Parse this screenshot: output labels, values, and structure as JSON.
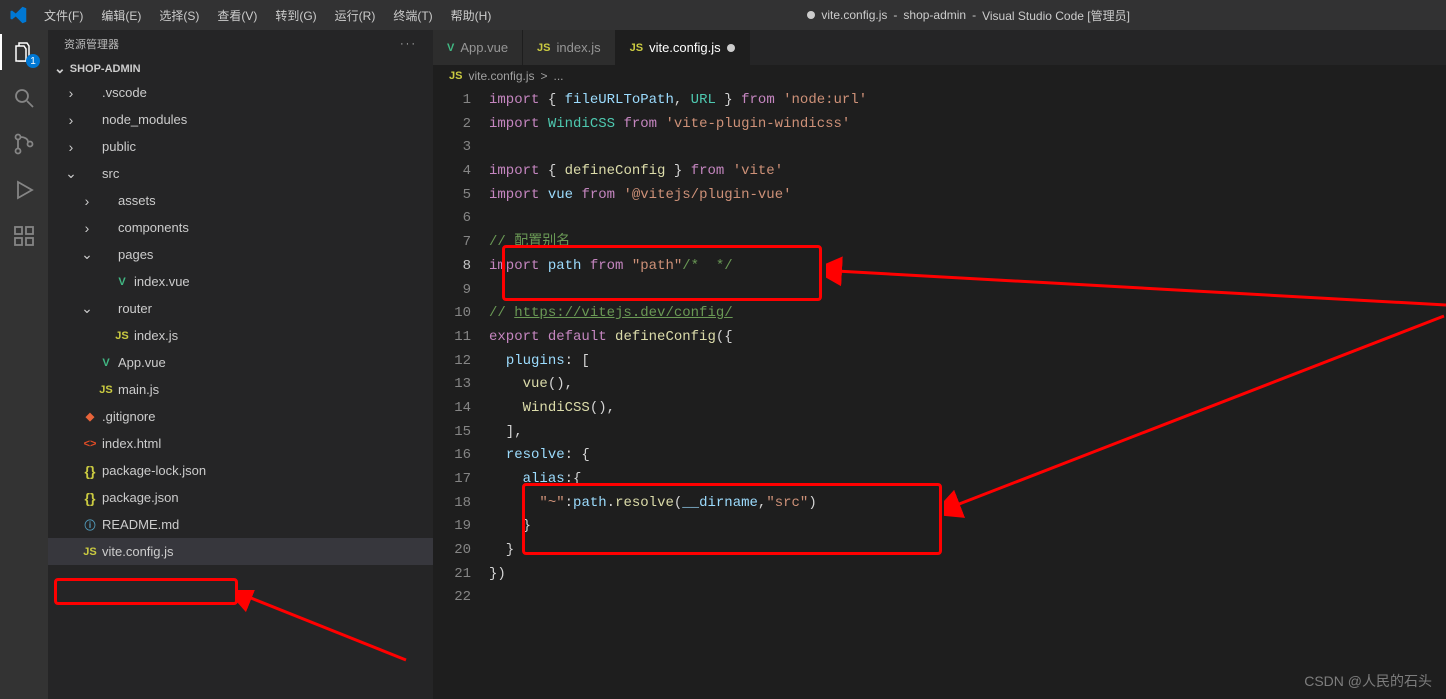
{
  "titlebar": {
    "menus": [
      "文件(F)",
      "编辑(E)",
      "选择(S)",
      "查看(V)",
      "转到(G)",
      "运行(R)",
      "终端(T)",
      "帮助(H)"
    ],
    "title_file": "vite.config.js",
    "title_project": "shop-admin",
    "title_app": "Visual Studio Code [管理员]"
  },
  "activitybar": {
    "badge": "1"
  },
  "sidebar": {
    "title": "资源管理器",
    "folder": "SHOP-ADMIN",
    "tree": [
      {
        "indent": 0,
        "twisty": ">",
        "icon": "",
        "label": ".vscode",
        "type": "folder"
      },
      {
        "indent": 0,
        "twisty": ">",
        "icon": "",
        "label": "node_modules",
        "type": "folder"
      },
      {
        "indent": 0,
        "twisty": ">",
        "icon": "",
        "label": "public",
        "type": "folder"
      },
      {
        "indent": 0,
        "twisty": "v",
        "icon": "",
        "label": "src",
        "type": "folder"
      },
      {
        "indent": 1,
        "twisty": ">",
        "icon": "",
        "label": "assets",
        "type": "folder"
      },
      {
        "indent": 1,
        "twisty": ">",
        "icon": "",
        "label": "components",
        "type": "folder"
      },
      {
        "indent": 1,
        "twisty": "v",
        "icon": "",
        "label": "pages",
        "type": "folder"
      },
      {
        "indent": 2,
        "twisty": "",
        "icon": "vue",
        "label": "index.vue",
        "type": "file"
      },
      {
        "indent": 1,
        "twisty": "v",
        "icon": "",
        "label": "router",
        "type": "folder"
      },
      {
        "indent": 2,
        "twisty": "",
        "icon": "js",
        "label": "index.js",
        "type": "file"
      },
      {
        "indent": 1,
        "twisty": "",
        "icon": "vue",
        "label": "App.vue",
        "type": "file"
      },
      {
        "indent": 1,
        "twisty": "",
        "icon": "js",
        "label": "main.js",
        "type": "file"
      },
      {
        "indent": 0,
        "twisty": "",
        "icon": "git",
        "label": ".gitignore",
        "type": "file"
      },
      {
        "indent": 0,
        "twisty": "",
        "icon": "html",
        "label": "index.html",
        "type": "file"
      },
      {
        "indent": 0,
        "twisty": "",
        "icon": "json",
        "label": "package-lock.json",
        "type": "file"
      },
      {
        "indent": 0,
        "twisty": "",
        "icon": "json",
        "label": "package.json",
        "type": "file"
      },
      {
        "indent": 0,
        "twisty": "",
        "icon": "md",
        "label": "README.md",
        "type": "file"
      },
      {
        "indent": 0,
        "twisty": "",
        "icon": "js",
        "label": "vite.config.js",
        "type": "file",
        "selected": true
      }
    ]
  },
  "tabs": [
    {
      "icon": "vue",
      "label": "App.vue",
      "active": false,
      "dirty": false
    },
    {
      "icon": "js",
      "label": "index.js",
      "active": false,
      "dirty": false
    },
    {
      "icon": "js",
      "label": "vite.config.js",
      "active": true,
      "dirty": true
    }
  ],
  "breadcrumbs": {
    "icon": "js",
    "file": "vite.config.js",
    "sep": ">",
    "rest": "..."
  },
  "code": {
    "lines": [
      {
        "n": 1,
        "seg": [
          [
            "k",
            "import"
          ],
          [
            "p",
            " { "
          ],
          [
            "v",
            "fileURLToPath"
          ],
          [
            "p",
            ", "
          ],
          [
            "t",
            "URL"
          ],
          [
            "p",
            " } "
          ],
          [
            "k",
            "from"
          ],
          [
            "p",
            " "
          ],
          [
            "s",
            "'node:url'"
          ]
        ]
      },
      {
        "n": 2,
        "seg": [
          [
            "k",
            "import"
          ],
          [
            "p",
            " "
          ],
          [
            "t",
            "WindiCSS"
          ],
          [
            "p",
            " "
          ],
          [
            "k",
            "from"
          ],
          [
            "p",
            " "
          ],
          [
            "s",
            "'vite-plugin-windicss'"
          ]
        ]
      },
      {
        "n": 3,
        "seg": []
      },
      {
        "n": 4,
        "seg": [
          [
            "k",
            "import"
          ],
          [
            "p",
            " { "
          ],
          [
            "fn",
            "defineConfig"
          ],
          [
            "p",
            " } "
          ],
          [
            "k",
            "from"
          ],
          [
            "p",
            " "
          ],
          [
            "s",
            "'vite'"
          ]
        ]
      },
      {
        "n": 5,
        "seg": [
          [
            "k",
            "import"
          ],
          [
            "p",
            " "
          ],
          [
            "v",
            "vue"
          ],
          [
            "p",
            " "
          ],
          [
            "k",
            "from"
          ],
          [
            "p",
            " "
          ],
          [
            "s",
            "'@vitejs/plugin-vue'"
          ]
        ]
      },
      {
        "n": 6,
        "seg": []
      },
      {
        "n": 7,
        "seg": [
          [
            "c",
            "// 配置别名"
          ]
        ]
      },
      {
        "n": 8,
        "cur": true,
        "seg": [
          [
            "k",
            "import"
          ],
          [
            "p",
            " "
          ],
          [
            "v",
            "path"
          ],
          [
            "p",
            " "
          ],
          [
            "k",
            "from"
          ],
          [
            "p",
            " "
          ],
          [
            "s",
            "\"path\""
          ],
          [
            "c",
            "/*  */"
          ]
        ]
      },
      {
        "n": 9,
        "seg": []
      },
      {
        "n": 10,
        "seg": [
          [
            "c",
            "// "
          ],
          [
            "link",
            "https://vitejs.dev/config/"
          ]
        ]
      },
      {
        "n": 11,
        "seg": [
          [
            "k",
            "export"
          ],
          [
            "p",
            " "
          ],
          [
            "k",
            "default"
          ],
          [
            "p",
            " "
          ],
          [
            "fn",
            "defineConfig"
          ],
          [
            "p",
            "({"
          ]
        ]
      },
      {
        "n": 12,
        "seg": [
          [
            "p",
            "  "
          ],
          [
            "v",
            "plugins"
          ],
          [
            "p",
            ": ["
          ]
        ]
      },
      {
        "n": 13,
        "seg": [
          [
            "p",
            "    "
          ],
          [
            "fn",
            "vue"
          ],
          [
            "p",
            "(),"
          ]
        ]
      },
      {
        "n": 14,
        "seg": [
          [
            "p",
            "    "
          ],
          [
            "fn",
            "WindiCSS"
          ],
          [
            "p",
            "(),"
          ]
        ]
      },
      {
        "n": 15,
        "seg": [
          [
            "p",
            "  ],"
          ]
        ]
      },
      {
        "n": 16,
        "seg": [
          [
            "p",
            "  "
          ],
          [
            "v",
            "resolve"
          ],
          [
            "p",
            ": {"
          ]
        ]
      },
      {
        "n": 17,
        "seg": [
          [
            "p",
            "    "
          ],
          [
            "v",
            "alias"
          ],
          [
            "p",
            ":{"
          ]
        ]
      },
      {
        "n": 18,
        "seg": [
          [
            "p",
            "      "
          ],
          [
            "s",
            "\"~\""
          ],
          [
            "p",
            ":"
          ],
          [
            "v",
            "path"
          ],
          [
            "p",
            "."
          ],
          [
            "fn",
            "resolve"
          ],
          [
            "p",
            "("
          ],
          [
            "v",
            "__dirname"
          ],
          [
            "p",
            ","
          ],
          [
            "s",
            "\"src\""
          ],
          [
            "p",
            ")"
          ]
        ]
      },
      {
        "n": 19,
        "seg": [
          [
            "p",
            "    }"
          ]
        ]
      },
      {
        "n": 20,
        "seg": [
          [
            "p",
            "  }"
          ]
        ]
      },
      {
        "n": 21,
        "seg": [
          [
            "p",
            "})"
          ]
        ]
      },
      {
        "n": 22,
        "seg": []
      }
    ]
  },
  "watermark": "CSDN @人民的石头"
}
